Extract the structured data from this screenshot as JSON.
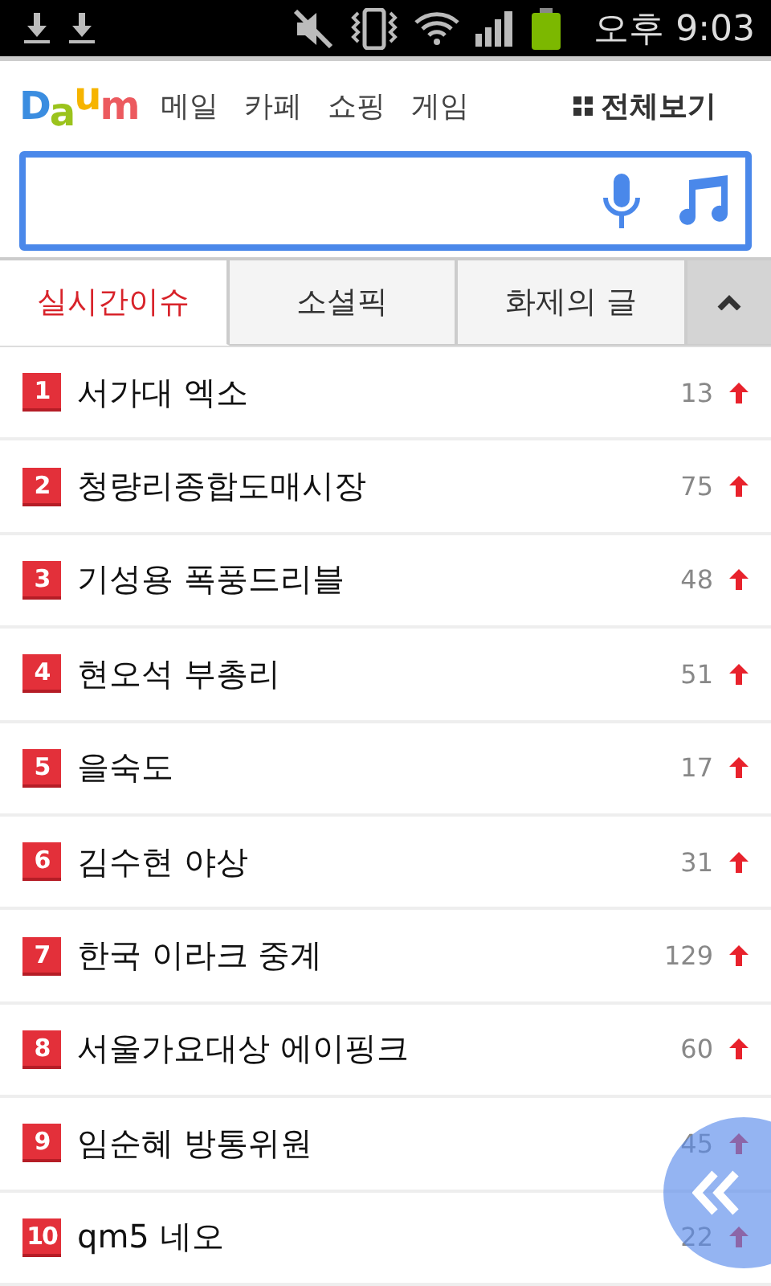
{
  "status_bar": {
    "time": "오후 9:03"
  },
  "header": {
    "logo": "Daum",
    "nav": [
      "메일",
      "카페",
      "쇼핑",
      "게임"
    ],
    "all_menu": "전체보기"
  },
  "tabs": [
    {
      "label": "실시간이슈",
      "selected": true
    },
    {
      "label": "소셜픽",
      "selected": false
    },
    {
      "label": "화제의 글",
      "selected": false
    }
  ],
  "issues": [
    {
      "rank": "1",
      "title": "서가대 엑소",
      "count": "13",
      "rising": true
    },
    {
      "rank": "2",
      "title": "청량리종합도매시장",
      "count": "75",
      "rising": true
    },
    {
      "rank": "3",
      "title": "기성용 폭풍드리블",
      "count": "48",
      "rising": true
    },
    {
      "rank": "4",
      "title": "현오석 부총리",
      "count": "51",
      "rising": true
    },
    {
      "rank": "5",
      "title": "을숙도",
      "count": "17",
      "rising": true
    },
    {
      "rank": "6",
      "title": "김수현 야상",
      "count": "31",
      "rising": true
    },
    {
      "rank": "7",
      "title": "한국 이라크 중계",
      "count": "129",
      "rising": true
    },
    {
      "rank": "8",
      "title": "서울가요대상 에이핑크",
      "count": "60",
      "rising": true
    },
    {
      "rank": "9",
      "title": "임순혜 방통위원",
      "count": "45",
      "rising": true
    },
    {
      "rank": "10",
      "title": "qm5 네오",
      "count": "22",
      "rising": true
    }
  ]
}
